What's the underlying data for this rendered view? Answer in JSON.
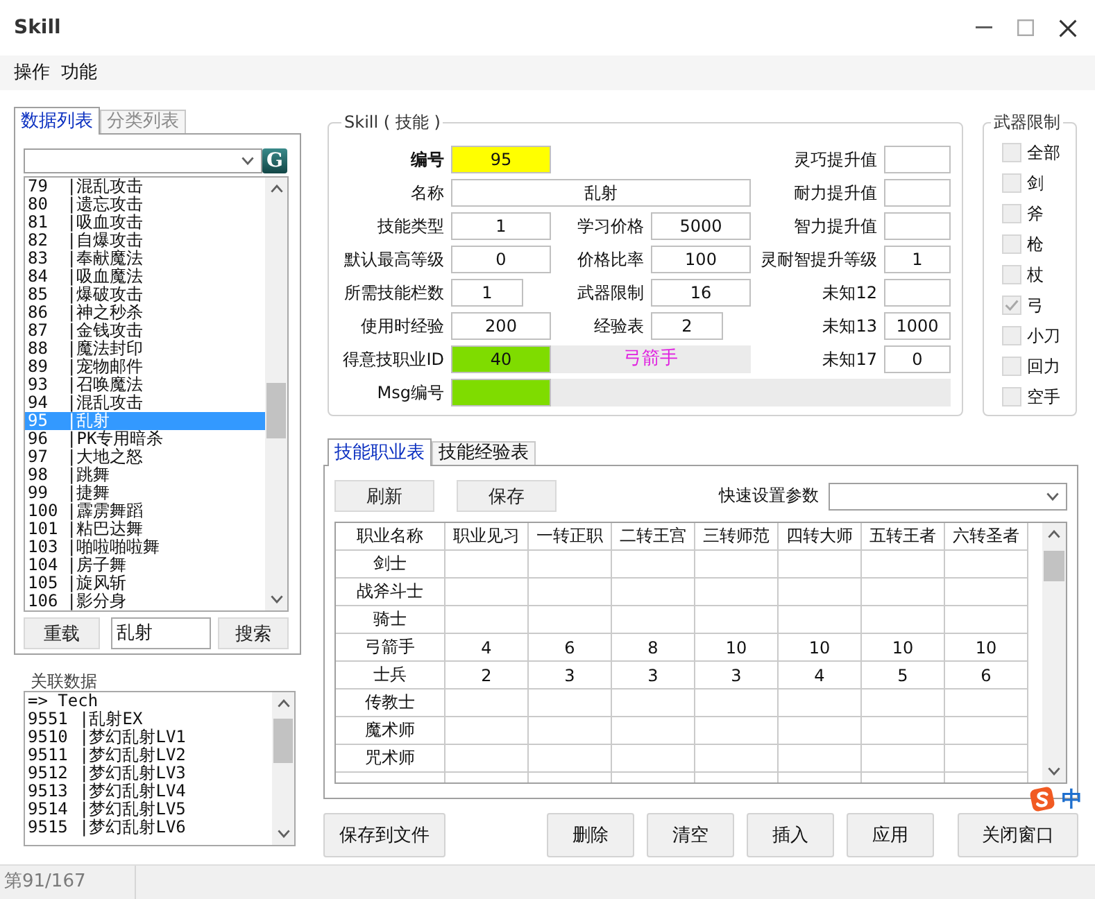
{
  "window": {
    "title": "Skill"
  },
  "menu": [
    {
      "label": "操作"
    },
    {
      "label": "功能"
    }
  ],
  "left_tabs": [
    {
      "label": "数据列表",
      "selected": true,
      "disabled": false
    },
    {
      "label": "分类列表",
      "selected": false,
      "disabled": true
    }
  ],
  "data_list": {
    "go_button": "G",
    "items": [
      {
        "number": "79",
        "name": "|混乱攻击",
        "selected": false
      },
      {
        "number": "80",
        "name": "|遗忘攻击",
        "selected": false
      },
      {
        "number": "81",
        "name": "|吸血攻击",
        "selected": false
      },
      {
        "number": "82",
        "name": "|自爆攻击",
        "selected": false
      },
      {
        "number": "83",
        "name": "|奉献魔法",
        "selected": false
      },
      {
        "number": "84",
        "name": "|吸血魔法",
        "selected": false
      },
      {
        "number": "85",
        "name": "|爆破攻击",
        "selected": false
      },
      {
        "number": "86",
        "name": "|神之秒杀",
        "selected": false
      },
      {
        "number": "87",
        "name": "|金钱攻击",
        "selected": false
      },
      {
        "number": "88",
        "name": "|魔法封印",
        "selected": false
      },
      {
        "number": "89",
        "name": "|宠物邮件",
        "selected": false
      },
      {
        "number": "93",
        "name": "|召唤魔法",
        "selected": false
      },
      {
        "number": "94",
        "name": "|混乱攻击",
        "selected": false
      },
      {
        "number": "95",
        "name": "|乱射",
        "selected": true
      },
      {
        "number": "96",
        "name": "|PK专用暗杀",
        "selected": false
      },
      {
        "number": "97",
        "name": "|大地之怒",
        "selected": false
      },
      {
        "number": "98",
        "name": "|跳舞",
        "selected": false
      },
      {
        "number": "99",
        "name": "|捷舞",
        "selected": false
      },
      {
        "number": "100",
        "name": "|霹雳舞蹈",
        "selected": false
      },
      {
        "number": "101",
        "name": "|粘巴达舞",
        "selected": false
      },
      {
        "number": "103",
        "name": "|啪啦啪啦舞",
        "selected": false
      },
      {
        "number": "104",
        "name": "|房子舞",
        "selected": false
      },
      {
        "number": "105",
        "name": "|旋风斩",
        "selected": false
      },
      {
        "number": "106",
        "name": "|影分身",
        "selected": false
      }
    ]
  },
  "search": {
    "reload_button": "重载",
    "value": "乱射",
    "search_button": "搜索"
  },
  "related": {
    "title": "关联数据",
    "header": "=> Tech",
    "items": [
      {
        "number": "9551",
        "name": "|乱射EX"
      },
      {
        "number": "9510",
        "name": "|梦幻乱射LV1"
      },
      {
        "number": "9511",
        "name": "|梦幻乱射LV2"
      },
      {
        "number": "9512",
        "name": "|梦幻乱射LV3"
      },
      {
        "number": "9513",
        "name": "|梦幻乱射LV4"
      },
      {
        "number": "9514",
        "name": "|梦幻乱射LV5"
      },
      {
        "number": "9515",
        "name": "|梦幻乱射LV6"
      }
    ]
  },
  "skill_form": {
    "title": "Skill ( 技能 )",
    "rows": [
      {
        "left": {
          "label": "编号",
          "value": "95",
          "kind": "key"
        },
        "right": {
          "label": "灵巧提升值",
          "kind": "plain"
        }
      },
      {
        "left": {
          "label": "名称",
          "value": "乱射",
          "kind": "wide"
        },
        "right": {
          "label": "耐力提升值",
          "kind": "plain"
        }
      },
      {
        "left": {
          "label": "技能类型",
          "value": "1",
          "kind": "plain"
        },
        "middle": {
          "label": "学习价格",
          "value": "5000",
          "kind": "plain"
        },
        "right": {
          "label": "智力提升值",
          "kind": "plain"
        }
      },
      {
        "left": {
          "label": "默认最高等级",
          "value": "0",
          "kind": "plain"
        },
        "middle": {
          "label": "价格比率",
          "value": "100",
          "kind": "plain"
        },
        "right": {
          "label": "灵耐智提升等级",
          "value": "1",
          "kind": "plain"
        }
      },
      {
        "left": {
          "label": "所需技能栏数",
          "value": "1",
          "kind": "short"
        },
        "middle": {
          "label": "武器限制",
          "value": "16",
          "kind": "plain"
        },
        "right": {
          "label": "未知12",
          "kind": "plain"
        }
      },
      {
        "left": {
          "label": "使用时经验",
          "value": "200",
          "kind": "plain"
        },
        "middle": {
          "label": "经验表",
          "value": "2",
          "kind": "short"
        },
        "right": {
          "label": "未知13",
          "value": "1000",
          "kind": "plain"
        }
      },
      {
        "left": {
          "label": "得意技职业ID",
          "value": "40",
          "kind": "link"
        },
        "middle": {
          "value": "弓箭手",
          "kind": "readout"
        },
        "right": {
          "label": "未知17",
          "value": "0",
          "kind": "plain"
        }
      },
      {
        "left": {
          "label": "Msg编号",
          "kind": "link"
        },
        "middle": {
          "kind": "readout_wide"
        }
      }
    ]
  },
  "weapon_limit": {
    "title": "武器限制",
    "options": [
      {
        "label": "全部",
        "checked": false
      },
      {
        "label": "剑",
        "checked": false
      },
      {
        "label": "斧",
        "checked": false
      },
      {
        "label": "枪",
        "checked": false
      },
      {
        "label": "杖",
        "checked": false
      },
      {
        "label": "弓",
        "checked": true
      },
      {
        "label": "小刀",
        "checked": false
      },
      {
        "label": "回力",
        "checked": false
      },
      {
        "label": "空手",
        "checked": false
      }
    ]
  },
  "table_tabs": [
    {
      "label": "技能职业表",
      "selected": true
    },
    {
      "label": "技能经验表",
      "selected": false
    }
  ],
  "table_toolbar": {
    "buttons": [
      {
        "label": "刷新"
      },
      {
        "label": "保存"
      }
    ],
    "quick_set_label": "快速设置参数"
  },
  "job_table": {
    "columns": [
      "职业名称",
      "职业见习",
      "一转正职",
      "二转王宫",
      "三转师范",
      "四转大师",
      "五转王者",
      "六转圣者"
    ],
    "rows": [
      {
        "name": "剑士"
      },
      {
        "name": "战斧斗士"
      },
      {
        "name": "骑士"
      },
      {
        "name": "弓箭手",
        "values": [
          "4",
          "6",
          "8",
          "10",
          "10",
          "10",
          "10"
        ]
      },
      {
        "name": "士兵",
        "values": [
          "2",
          "3",
          "3",
          "3",
          "4",
          "5",
          "6"
        ]
      },
      {
        "name": "传教士"
      },
      {
        "name": "魔术师"
      },
      {
        "name": "咒术师"
      }
    ]
  },
  "actions": {
    "file_button": "保存到文件",
    "buttons": [
      {
        "label": "删除"
      },
      {
        "label": "清空"
      },
      {
        "label": "插入"
      },
      {
        "label": "应用"
      }
    ],
    "close_button": "关闭窗口"
  },
  "status_bar": {
    "text": "第91/167"
  },
  "ime": {
    "mode": "中"
  }
}
